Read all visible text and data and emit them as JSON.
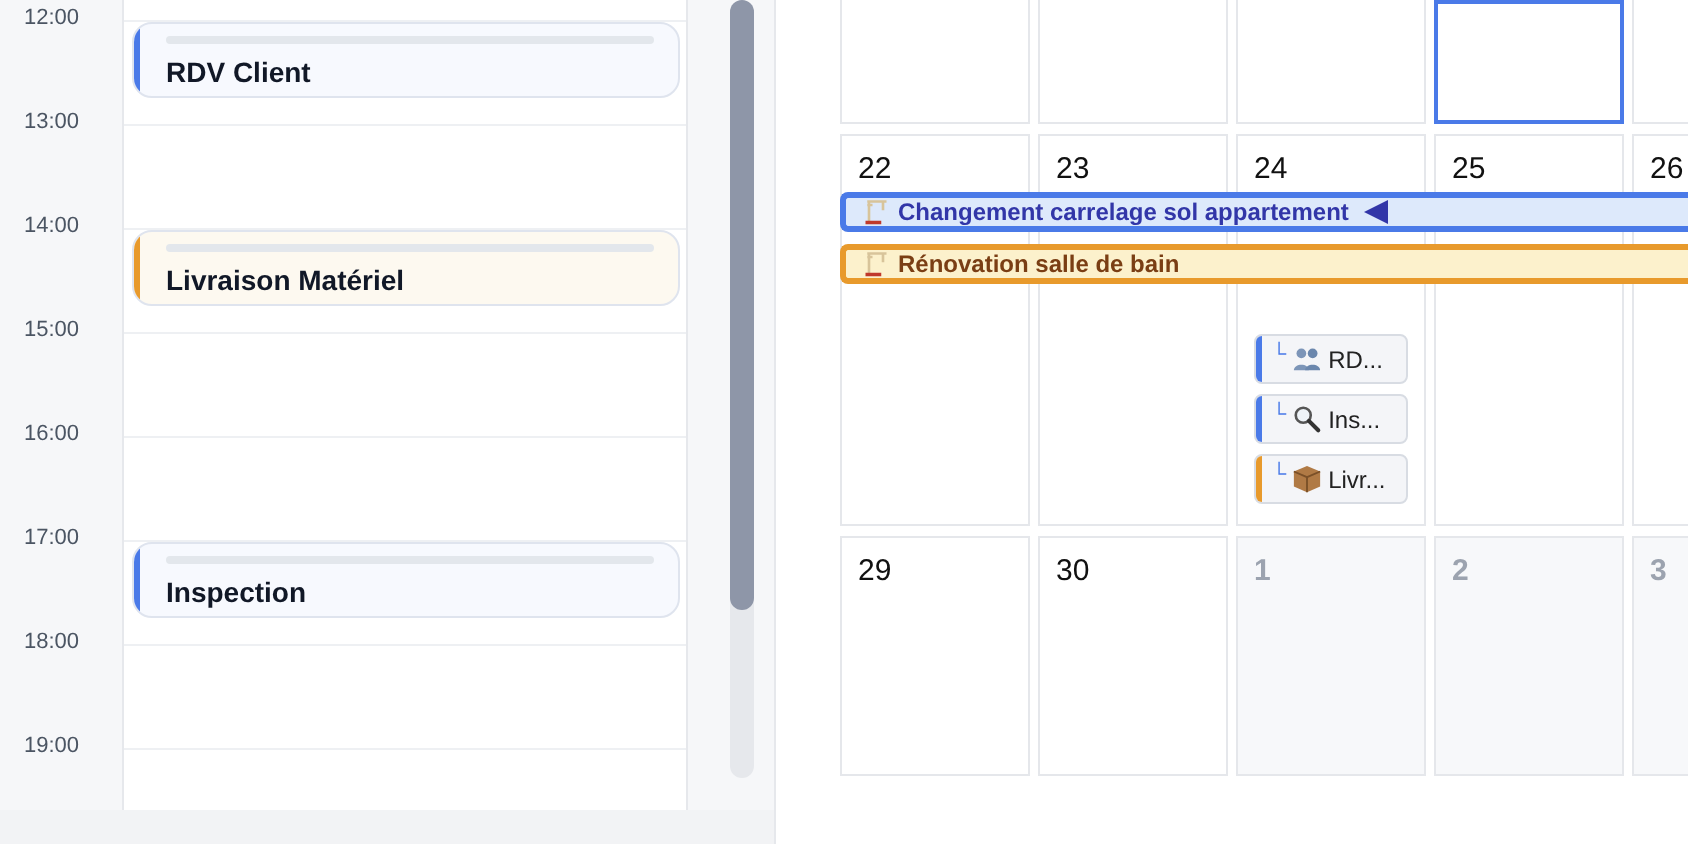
{
  "day_view": {
    "hours": [
      {
        "time": "12:00",
        "event": {
          "title": "RDV Client",
          "color": "#4a7ae8"
        }
      },
      {
        "time": "13:00"
      },
      {
        "time": "14:00",
        "event": {
          "title": "Livraison Matériel",
          "color": "#e89a2c"
        }
      },
      {
        "time": "15:00"
      },
      {
        "time": "16:00"
      },
      {
        "time": "17:00",
        "event": {
          "title": "Inspection",
          "color": "#4a7ae8"
        }
      },
      {
        "time": "18:00"
      },
      {
        "time": "19:00"
      }
    ]
  },
  "month_view": {
    "weeks": [
      {
        "days": [
          {
            "today": false
          },
          {
            "today": false
          },
          {
            "today": false
          },
          {
            "today": true
          },
          {
            "today": false
          }
        ]
      },
      {
        "days": [
          {
            "date": "22",
            "today": false,
            "other_month": false
          },
          {
            "date": "23",
            "today": false,
            "other_month": false
          },
          {
            "date": "24",
            "today": false,
            "other_month": false,
            "chips": [
              {
                "prefix": "└",
                "kind": "meeting",
                "label": "RD...",
                "color": "#4a7ae8"
              },
              {
                "prefix": "└",
                "kind": "inspection",
                "label": "Ins...",
                "color": "#4a7ae8"
              },
              {
                "prefix": "└",
                "kind": "delivery",
                "label": "Livr...",
                "color": "#e89a2c"
              }
            ]
          },
          {
            "date": "25",
            "today": false,
            "other_month": false
          },
          {
            "date": "26",
            "today": false,
            "other_month": false
          }
        ],
        "bars": [
          {
            "title": "Changement carrelage sol appartement",
            "color": "#4a7ae8",
            "selected": true
          },
          {
            "title": "Rénovation salle de bain",
            "color": "#e89a2c",
            "selected": false
          }
        ]
      },
      {
        "days": [
          {
            "date": "29",
            "today": false,
            "other_month": false
          },
          {
            "date": "30",
            "today": false,
            "other_month": false
          },
          {
            "date": "1",
            "today": false,
            "other_month": true
          },
          {
            "date": "2",
            "today": false,
            "other_month": true
          },
          {
            "date": "3",
            "today": false,
            "other_month": true
          }
        ]
      }
    ]
  }
}
